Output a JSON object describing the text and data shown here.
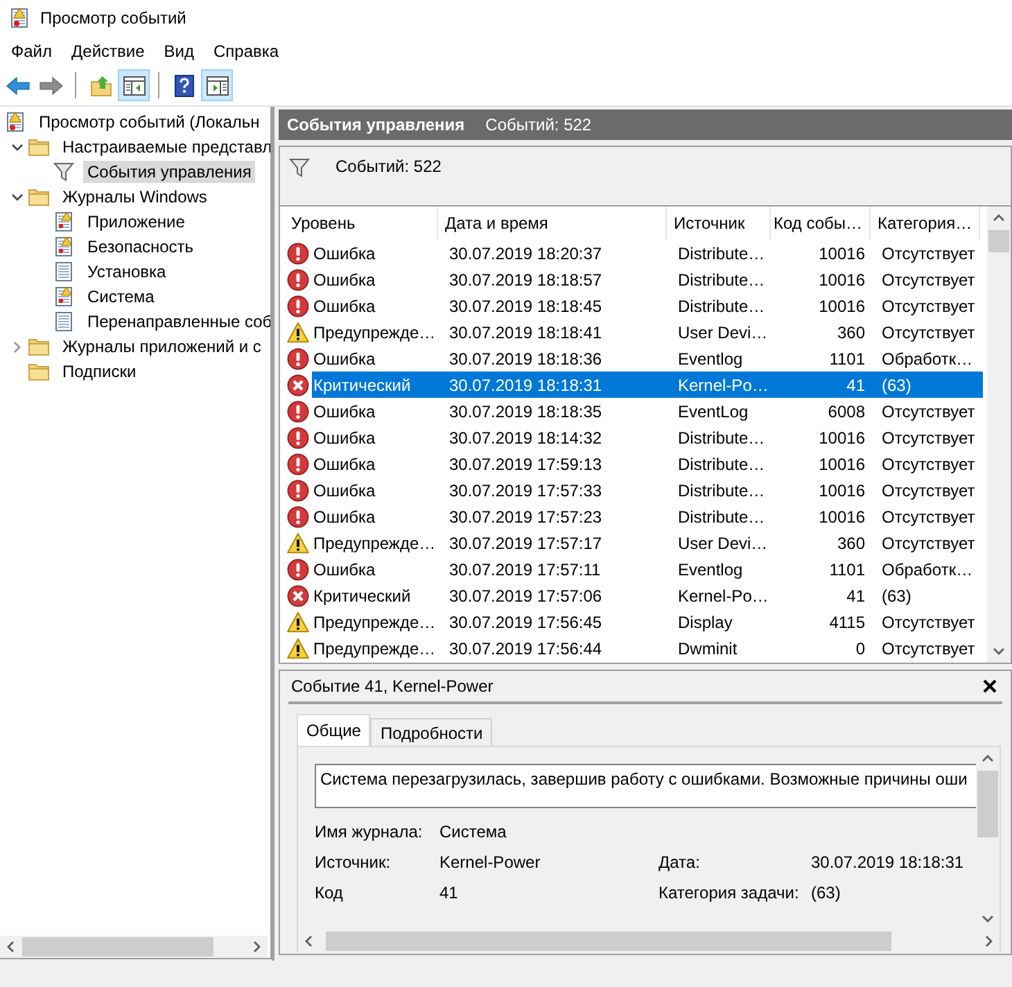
{
  "window": {
    "title": "Просмотр событий"
  },
  "menu": [
    "Файл",
    "Действие",
    "Вид",
    "Справка"
  ],
  "toolbar": {
    "groups": [
      [
        {
          "kind": "back",
          "disabled": false,
          "pressed": false
        },
        {
          "kind": "forward",
          "disabled": true,
          "pressed": false
        }
      ],
      [
        {
          "kind": "up",
          "disabled": false,
          "pressed": false
        },
        {
          "kind": "tree",
          "disabled": false,
          "pressed": true
        }
      ],
      [
        {
          "kind": "help",
          "disabled": false,
          "pressed": false
        },
        {
          "kind": "actions",
          "disabled": false,
          "pressed": true
        }
      ]
    ]
  },
  "tree": {
    "items": [
      {
        "label": "Просмотр событий (Локальн",
        "kind": "root",
        "selected": false,
        "children": [
          {
            "label": "Настраиваемые представл",
            "kind": "folder",
            "selected": false,
            "expanded": true,
            "children": [
              {
                "label": "События управления",
                "kind": "filter",
                "selected": true
              }
            ]
          },
          {
            "label": "Журналы Windows",
            "kind": "folder",
            "selected": false,
            "expanded": true,
            "children": [
              {
                "label": "Приложение",
                "kind": "log",
                "selected": false
              },
              {
                "label": "Безопасность",
                "kind": "log",
                "selected": false
              },
              {
                "label": "Установка",
                "kind": "page",
                "selected": false
              },
              {
                "label": "Система",
                "kind": "log",
                "selected": false
              },
              {
                "label": "Перенаправленные соб",
                "kind": "page",
                "selected": false
              }
            ]
          },
          {
            "label": "Журналы приложений и с",
            "kind": "folder",
            "selected": false,
            "expanded": false
          },
          {
            "label": "Подписки",
            "kind": "folder",
            "selected": false
          }
        ]
      }
    ]
  },
  "view": {
    "title": "События управления",
    "count": "Событий: 522"
  },
  "filter": {
    "text": "Событий: 522"
  },
  "table": {
    "columns": [
      {
        "label": "Уровень"
      },
      {
        "label": "Дата и время"
      },
      {
        "label": "Источник"
      },
      {
        "label": "Код собы…",
        "numeric": true
      },
      {
        "label": "Категория…"
      }
    ],
    "rows": [
      {
        "kind": "error",
        "selected": false,
        "cells": [
          "Ошибка",
          "30.07.2019 18:20:37",
          "Distribute…",
          "10016",
          "Отсутствует"
        ]
      },
      {
        "kind": "error",
        "selected": false,
        "cells": [
          "Ошибка",
          "30.07.2019 18:18:57",
          "Distribute…",
          "10016",
          "Отсутствует"
        ]
      },
      {
        "kind": "error",
        "selected": false,
        "cells": [
          "Ошибка",
          "30.07.2019 18:18:45",
          "Distribute…",
          "10016",
          "Отсутствует"
        ]
      },
      {
        "kind": "warning",
        "selected": false,
        "cells": [
          "Предупрежде…",
          "30.07.2019 18:18:41",
          "User Devi…",
          "360",
          "Отсутствует"
        ]
      },
      {
        "kind": "error",
        "selected": false,
        "cells": [
          "Ошибка",
          "30.07.2019 18:18:36",
          "Eventlog",
          "1101",
          "Обработк…"
        ]
      },
      {
        "kind": "critical",
        "selected": true,
        "cells": [
          "Критический",
          "30.07.2019 18:18:31",
          "Kernel-Po…",
          "41",
          "(63)"
        ]
      },
      {
        "kind": "error",
        "selected": false,
        "cells": [
          "Ошибка",
          "30.07.2019 18:18:35",
          "EventLog",
          "6008",
          "Отсутствует"
        ]
      },
      {
        "kind": "error",
        "selected": false,
        "cells": [
          "Ошибка",
          "30.07.2019 18:14:32",
          "Distribute…",
          "10016",
          "Отсутствует"
        ]
      },
      {
        "kind": "error",
        "selected": false,
        "cells": [
          "Ошибка",
          "30.07.2019 17:59:13",
          "Distribute…",
          "10016",
          "Отсутствует"
        ]
      },
      {
        "kind": "error",
        "selected": false,
        "cells": [
          "Ошибка",
          "30.07.2019 17:57:33",
          "Distribute…",
          "10016",
          "Отсутствует"
        ]
      },
      {
        "kind": "error",
        "selected": false,
        "cells": [
          "Ошибка",
          "30.07.2019 17:57:23",
          "Distribute…",
          "10016",
          "Отсутствует"
        ]
      },
      {
        "kind": "warning",
        "selected": false,
        "cells": [
          "Предупрежде…",
          "30.07.2019 17:57:17",
          "User Devi…",
          "360",
          "Отсутствует"
        ]
      },
      {
        "kind": "error",
        "selected": false,
        "cells": [
          "Ошибка",
          "30.07.2019 17:57:11",
          "Eventlog",
          "1101",
          "Обработк…"
        ]
      },
      {
        "kind": "critical",
        "selected": false,
        "cells": [
          "Критический",
          "30.07.2019 17:57:06",
          "Kernel-Po…",
          "41",
          "(63)"
        ]
      },
      {
        "kind": "warning",
        "selected": false,
        "cells": [
          "Предупрежде…",
          "30.07.2019 17:56:45",
          "Display",
          "4115",
          "Отсутствует"
        ]
      },
      {
        "kind": "warning",
        "selected": false,
        "cells": [
          "Предупрежде…",
          "30.07.2019 17:56:44",
          "Dwminit",
          "0",
          "Отсутствует"
        ]
      }
    ]
  },
  "details": {
    "title": "Событие 41, Kernel-Power",
    "tabs": [
      {
        "label": "Общие",
        "selected": true
      },
      {
        "label": "Подробности",
        "selected": false
      }
    ],
    "description": "Система перезагрузилась, завершив работу с ошибками. Возможные причины оши",
    "fields": [
      [
        {
          "label": "Имя журнала:",
          "value": "Система"
        }
      ],
      [
        {
          "label": "Источник:",
          "value": "Kernel-Power"
        },
        {
          "label": "Дата:",
          "value": "30.07.2019 18:18:31"
        }
      ],
      [
        {
          "label": "Код",
          "value": "41"
        },
        {
          "label": "Категория задачи:",
          "value": "(63)"
        }
      ]
    ]
  }
}
